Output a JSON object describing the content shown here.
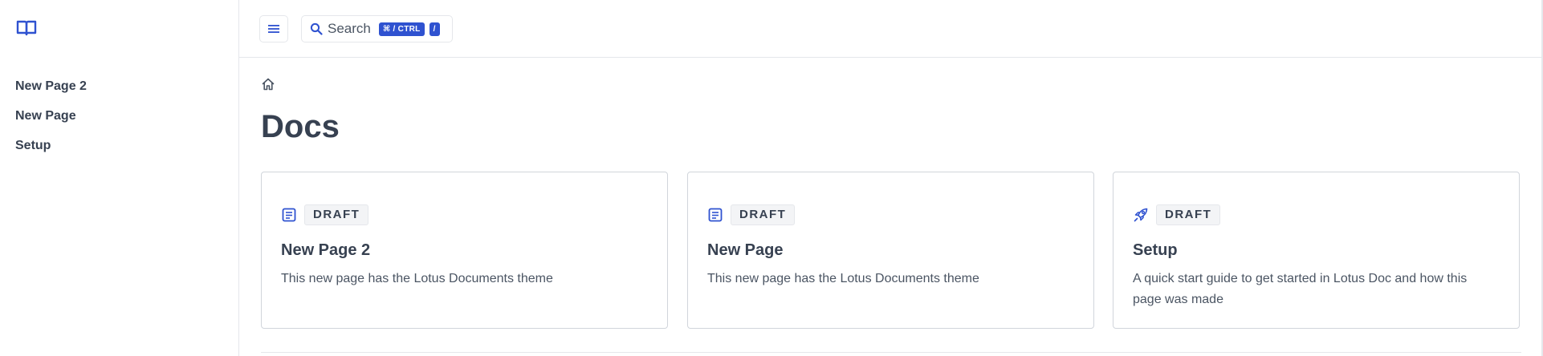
{
  "icons": {
    "logo": "book-open-icon",
    "menu": "hamburger-menu-icon",
    "search": "search-icon",
    "home": "home-icon"
  },
  "colors": {
    "accent": "#2f52d0",
    "text": "#374151",
    "border": "#e5e7eb"
  },
  "sidebar": {
    "items": [
      {
        "label": "New Page 2"
      },
      {
        "label": "New Page"
      },
      {
        "label": "Setup"
      }
    ]
  },
  "topbar": {
    "search_label": "Search",
    "shortcut_modifier": "⌘ / CTRL",
    "shortcut_key": "/"
  },
  "main": {
    "title": "Docs",
    "cards": [
      {
        "icon": "document-text-icon",
        "badge": "DRAFT",
        "title": "New Page 2",
        "description": "This new page has the Lotus Documents theme"
      },
      {
        "icon": "document-text-icon",
        "badge": "DRAFT",
        "title": "New Page",
        "description": "This new page has the Lotus Documents theme"
      },
      {
        "icon": "rocket-icon",
        "badge": "DRAFT",
        "title": "Setup",
        "description": "A quick start guide to get started in Lotus Doc and how this page was made"
      }
    ]
  }
}
